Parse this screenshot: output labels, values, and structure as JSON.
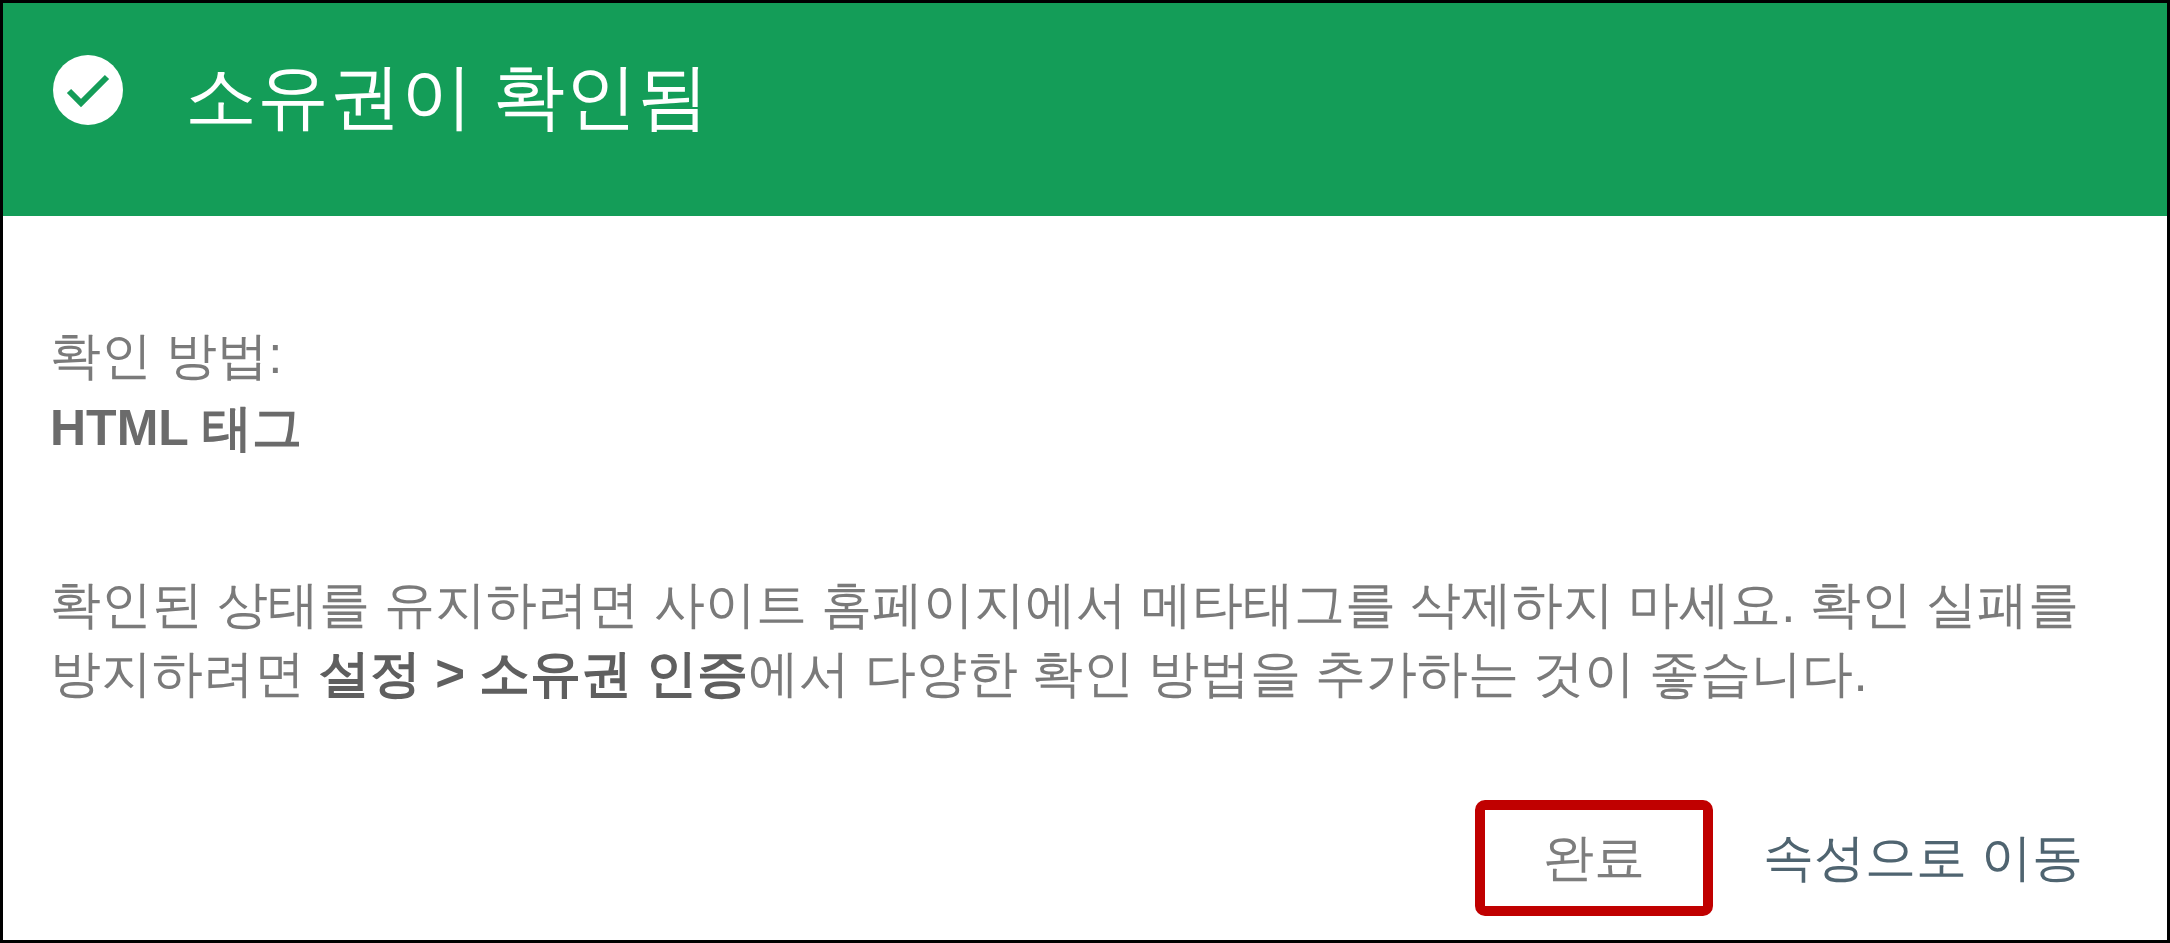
{
  "header": {
    "title": "소유권이 확인됨"
  },
  "method": {
    "label": "확인 방법:",
    "value": "HTML 태그"
  },
  "message": "확인된 상태를 유지하려면 사이트 홈페이지에서 메타태그를 삭제하지 마세요. 확인 실패를\n방지하려면 **설정 > 소유권 인증**에서 다양한 확인 방법을 추가하는 것이 좋습니다.",
  "buttons": [
    {
      "label": "완료",
      "kind": "secondary",
      "highlighted": true
    },
    {
      "label": "속성으로 이동",
      "kind": "primary",
      "highlighted": false
    }
  ]
}
